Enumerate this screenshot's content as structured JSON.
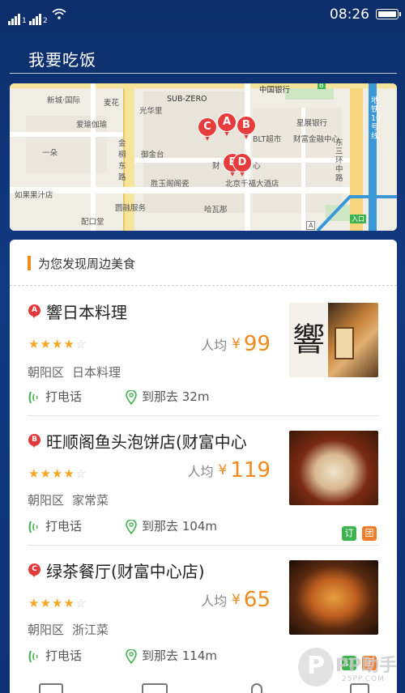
{
  "status_bar": {
    "sim1": "1",
    "sim2": "2",
    "time": "08:26"
  },
  "header": {
    "title": "我要吃饭"
  },
  "map": {
    "labels": {
      "bank": "中国银行",
      "xincheng": "新城·国际",
      "maikelong": "麦花",
      "subzero": "SUB-ZERO",
      "star_bank": "星展银行",
      "aiyu": "爱瑜伽瑜",
      "guangming": "光华里",
      "blt": "BLT超市",
      "caifu": "财富金融中心",
      "yiduo": "一朵",
      "jinzhu1": "金",
      "jinzhu2": "桐",
      "jinzhu3": "东",
      "jinzhu4": "路",
      "yujintai": "御金台",
      "caifu2": "财",
      "xin": "心",
      "dongsanhuan": "东三环中路",
      "metro": "地铁10号线",
      "shengyu": "胜玉阁阁瓷",
      "qianfu": "北京千福大酒店",
      "rujia": "如果果汁店",
      "yuanrui": "圆融服务",
      "peiji": "配口堂",
      "hahaina": "哈瓦那",
      "exit": "入口",
      "mark_a": "A",
      "mark_b": "B"
    },
    "pins": [
      "C",
      "A",
      "B",
      "E",
      "D"
    ]
  },
  "section": {
    "header": "为您发现周边美食"
  },
  "restaurants": [
    {
      "marker": "A",
      "name": "響日本料理",
      "rating": 4,
      "avg_label": "人均",
      "currency": "¥",
      "price": "99",
      "district": "朝阳区",
      "cuisine": "日本料理",
      "call_label": "打电话",
      "go_label": "到那去 32m",
      "thumb_text": "響"
    },
    {
      "marker": "B",
      "name": "旺顺阁鱼头泡饼店(财富中心",
      "rating": 4,
      "avg_label": "人均",
      "currency": "¥",
      "price": "119",
      "district": "朝阳区",
      "cuisine": "家常菜",
      "call_label": "打电话",
      "go_label": "到那去 104m",
      "tags": [
        "订",
        "团"
      ]
    },
    {
      "marker": "C",
      "name": "绿茶餐厅(财富中心店)",
      "rating": 4,
      "avg_label": "人均",
      "currency": "¥",
      "price": "65",
      "district": "朝阳区",
      "cuisine": "浙江菜",
      "call_label": "打电话",
      "go_label": "到那去 114m",
      "tags": [
        "订",
        "团"
      ]
    }
  ],
  "watermark": {
    "logo": "P",
    "text": "PP助手",
    "url": "25PP.COM"
  },
  "colors": {
    "accent": "#f08a1c",
    "pin": "#e63c3c",
    "background": "#123a82"
  }
}
